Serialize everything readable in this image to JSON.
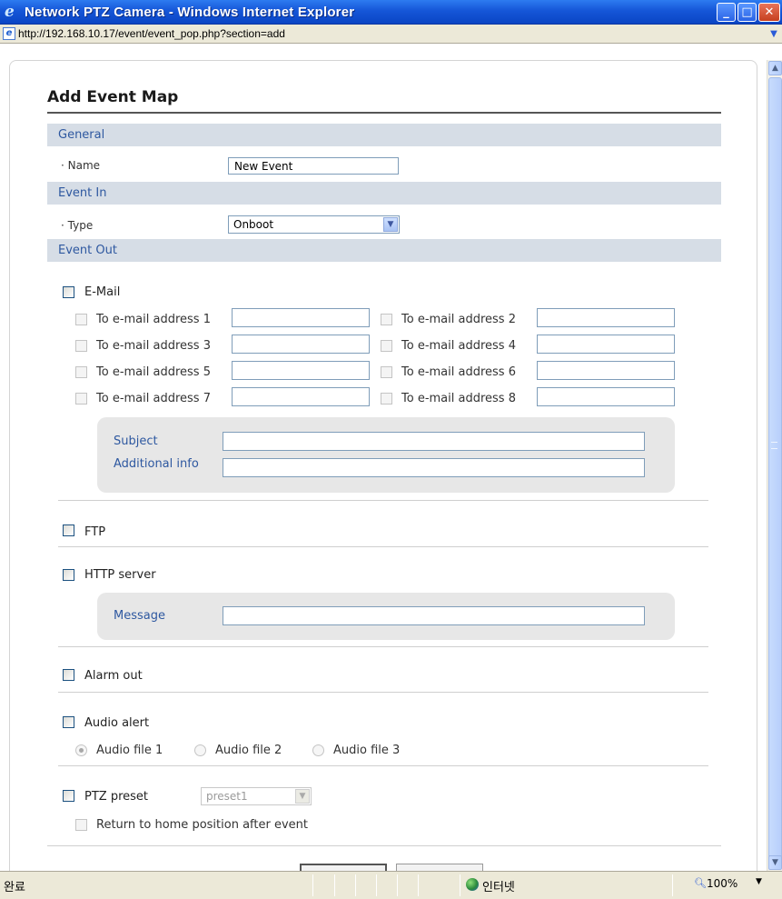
{
  "window": {
    "title": "Network PTZ Camera - Windows Internet Explorer",
    "url": "http://192.168.10.17/event/event_pop.php?section=add",
    "icons": [
      "ie-logo-icon",
      "minimize-icon",
      "maximize-icon",
      "close-icon",
      "page-icon",
      "dropdown-chevron-icon"
    ]
  },
  "page": {
    "title": "Add Event Map"
  },
  "general": {
    "header": "General",
    "name_label": "Name",
    "name_value": "New Event"
  },
  "event_in": {
    "header": "Event In",
    "type_label": "Type",
    "type_value": "Onboot"
  },
  "event_out": {
    "header": "Event Out",
    "email": {
      "label": "E-Mail",
      "addresses": [
        "To e-mail address 1",
        "To e-mail address 2",
        "To e-mail address 3",
        "To e-mail address 4",
        "To e-mail address 5",
        "To e-mail address 6",
        "To e-mail address 7",
        "To e-mail address 8"
      ],
      "subject_label": "Subject",
      "info_label": "Additional info"
    },
    "ftp_label": "FTP",
    "http": {
      "label": "HTTP server",
      "message_label": "Message"
    },
    "alarm_label": "Alarm out",
    "audio": {
      "label": "Audio alert",
      "files": [
        "Audio file 1",
        "Audio file 2",
        "Audio file 3"
      ],
      "selected": "Audio file 1"
    },
    "ptz": {
      "label": "PTZ preset",
      "preset_value": "preset1",
      "return_label": "Return to home position after event"
    }
  },
  "statusbar": {
    "status": "완료",
    "zone": "인터넷",
    "zoom": "100%"
  }
}
